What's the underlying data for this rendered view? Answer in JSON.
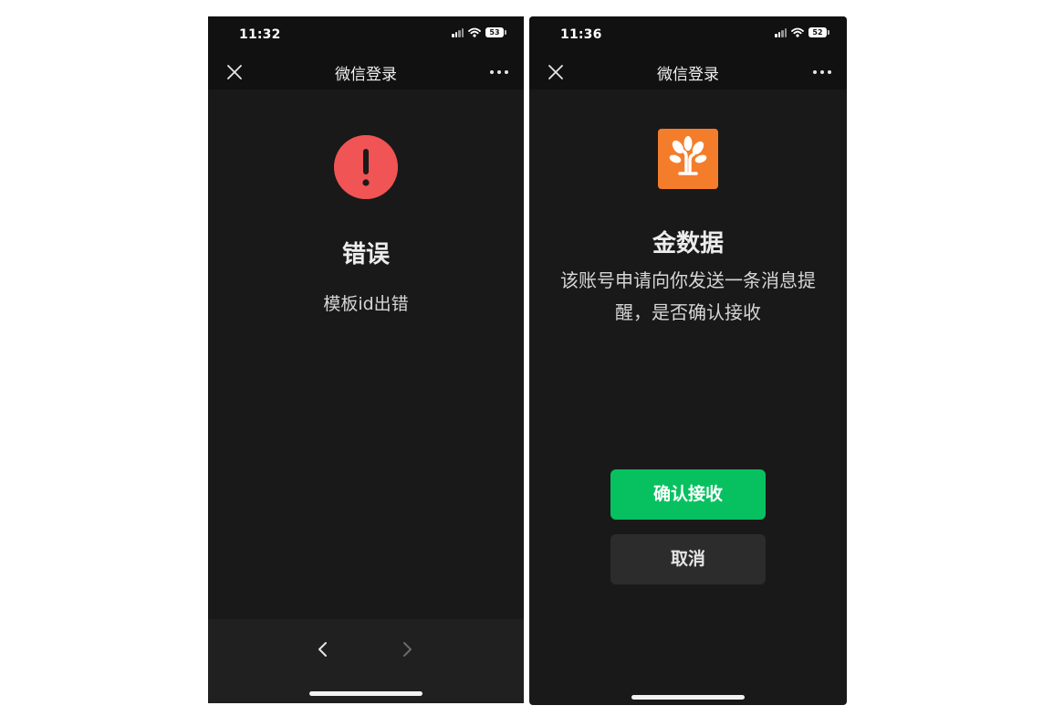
{
  "colors": {
    "background": "#191919",
    "bar": "#111111",
    "error_red": "#f05454",
    "confirm_green": "#07c160",
    "logo_orange": "#f47d2b"
  },
  "left_screen": {
    "status": {
      "time": "11:32",
      "battery": "53"
    },
    "nav": {
      "title": "微信登录",
      "close_icon": "close-icon",
      "more_icon": "more-icon"
    },
    "error_icon": "exclamation-circle-icon",
    "title": "错误",
    "message": "模板id出错",
    "bottom_nav": {
      "back_icon": "chevron-left-icon",
      "forward_icon": "chevron-right-icon"
    }
  },
  "right_screen": {
    "status": {
      "time": "11:36",
      "battery": "52"
    },
    "nav": {
      "title": "微信登录",
      "close_icon": "close-icon",
      "more_icon": "more-icon"
    },
    "app_logo_icon": "tree-logo-icon",
    "app_name": "金数据",
    "description": "该账号申请向你发送一条消息提醒，是否确认接收",
    "confirm_label": "确认接收",
    "cancel_label": "取消"
  }
}
